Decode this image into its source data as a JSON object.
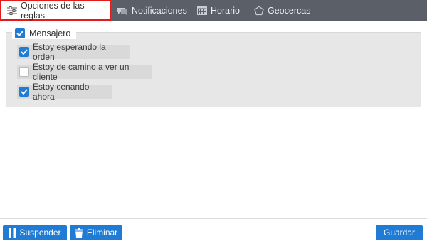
{
  "tabs": [
    {
      "label": "Opciones de las reglas",
      "icon": "sliders-icon",
      "active": true
    },
    {
      "label": "Notificaciones",
      "icon": "notifications-icon",
      "active": false
    },
    {
      "label": "Horario",
      "icon": "calendar-icon",
      "active": false
    },
    {
      "label": "Geocercas",
      "icon": "pentagon-icon",
      "active": false
    }
  ],
  "messenger": {
    "label": "Mensajero",
    "checked": true,
    "options": [
      {
        "label": "Estoy esperando la orden",
        "checked": true
      },
      {
        "label": "Estoy de camino a ver un cliente",
        "checked": false
      },
      {
        "label": "Estoy cenando ahora",
        "checked": true
      }
    ]
  },
  "footer": {
    "suspend_label": "Suspender",
    "delete_label": "Eliminar",
    "save_label": "Guardar"
  },
  "colors": {
    "accent": "#1f7bd3",
    "tabbar": "#5b6068",
    "active_tab_border": "#e21b1b"
  }
}
